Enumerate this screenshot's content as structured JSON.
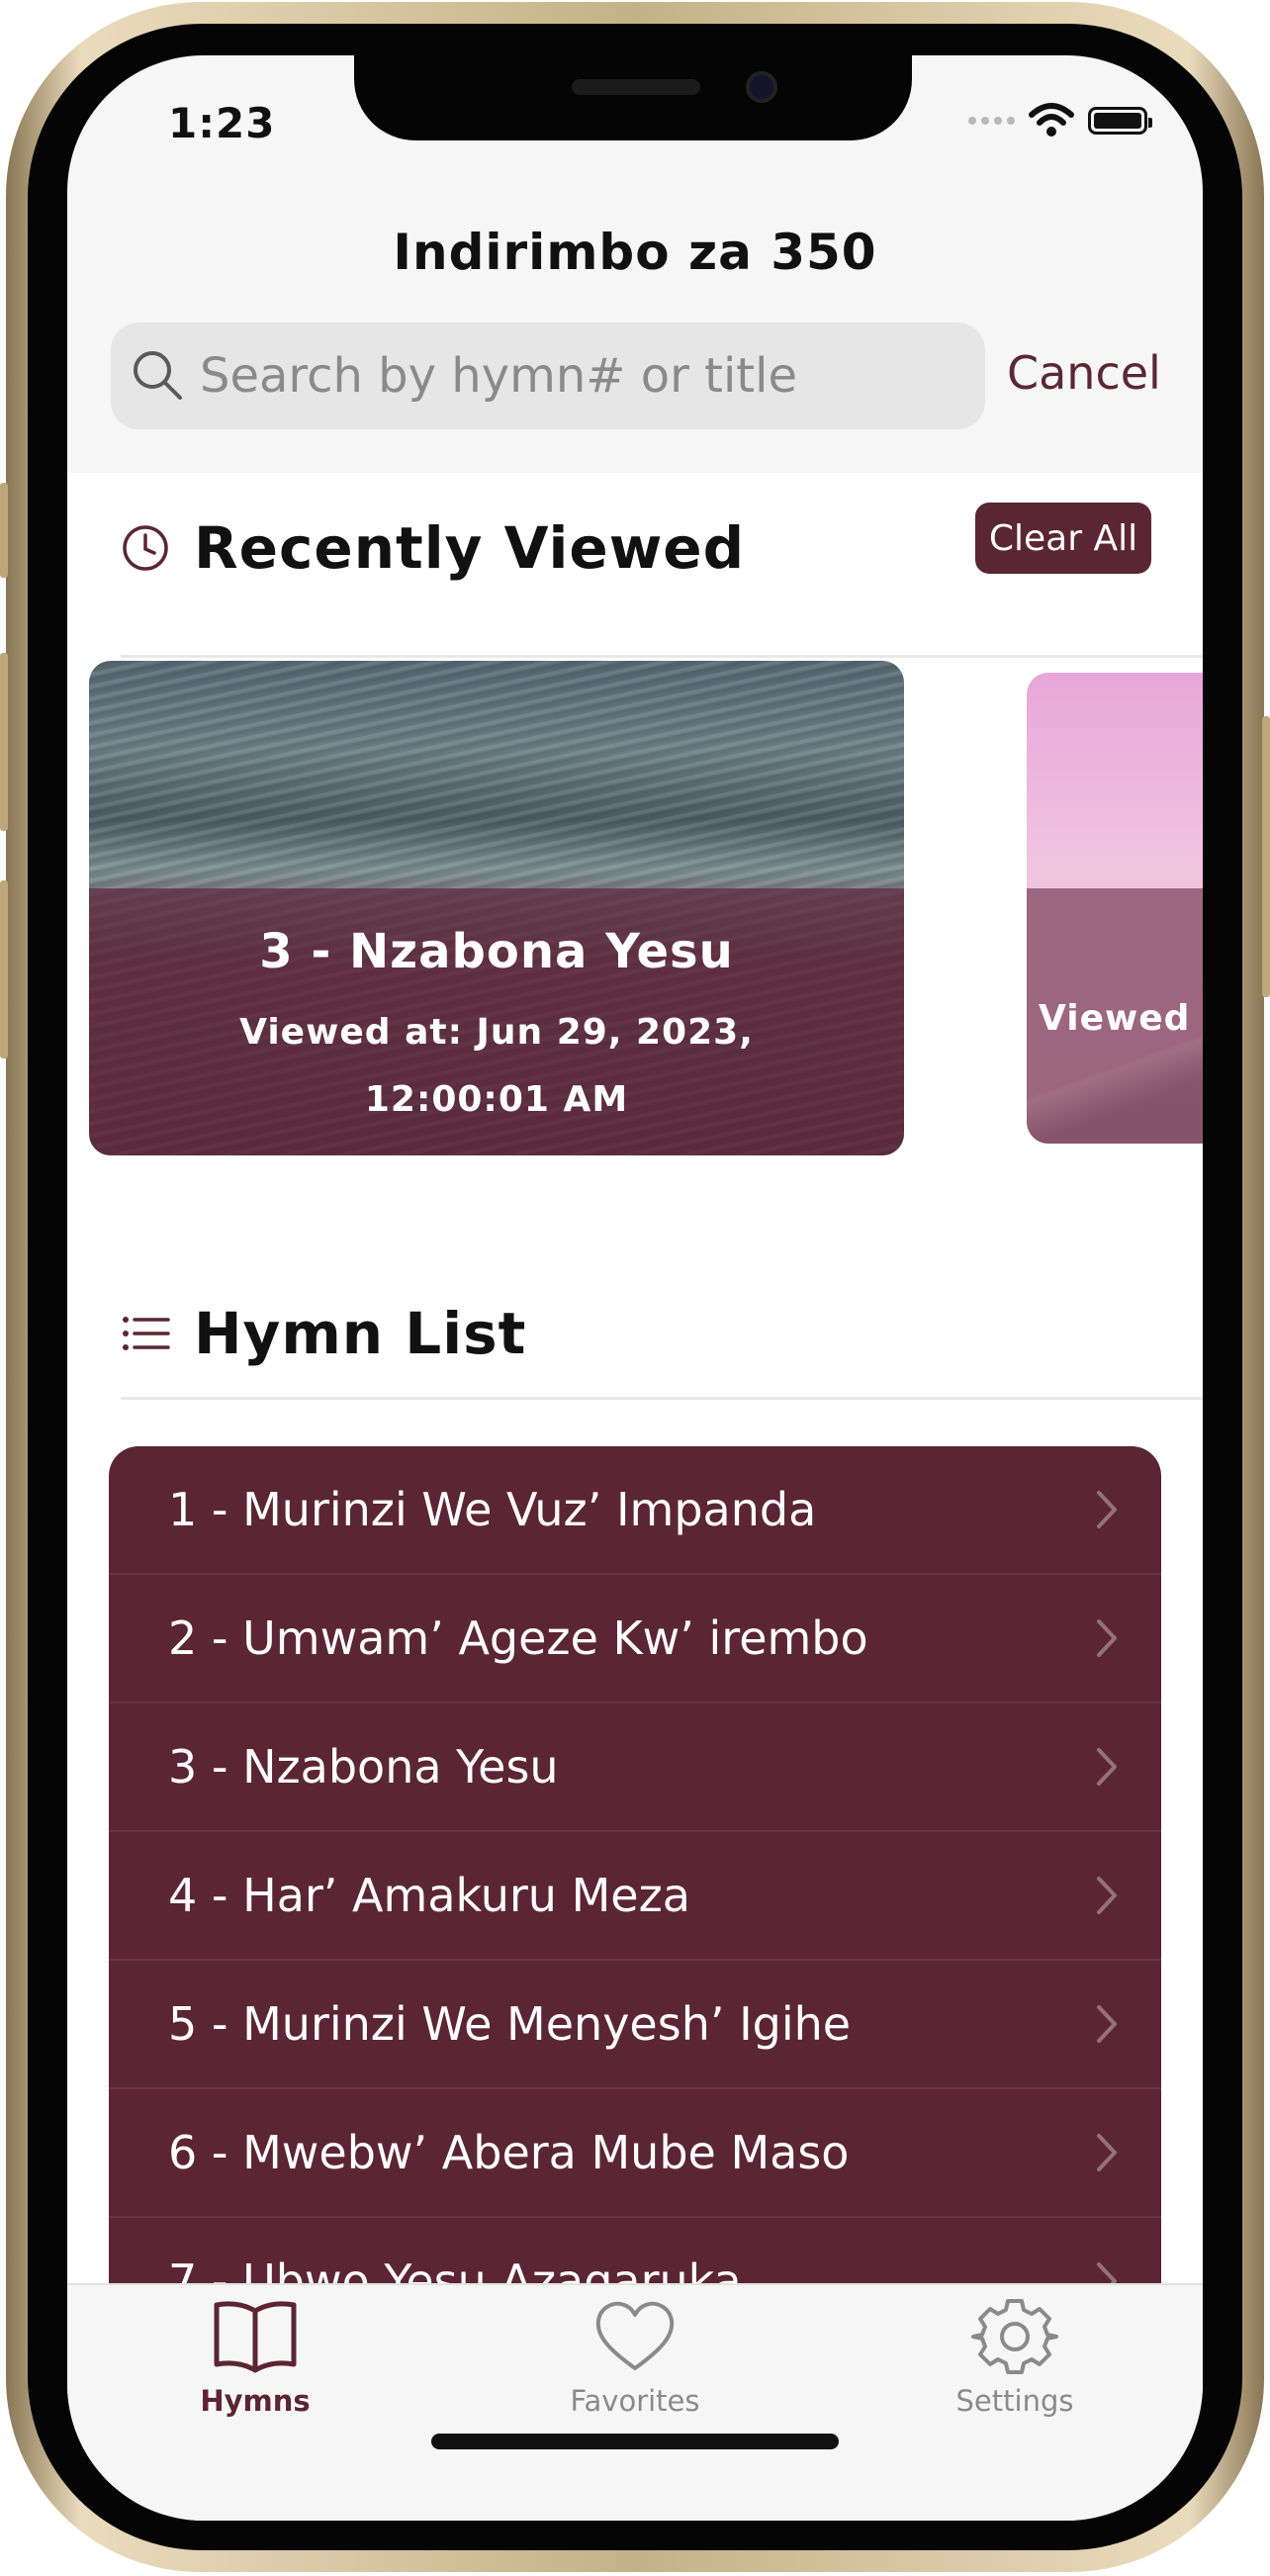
{
  "status_bar": {
    "time": "1:23"
  },
  "header": {
    "title": "Indirimbo za 350",
    "search_placeholder": "Search by hymn# or title",
    "cancel_label": "Cancel"
  },
  "recent": {
    "title": "Recently Viewed",
    "clear_label": "Clear All",
    "cards": [
      {
        "title": "3 - Nzabona Yesu",
        "viewed": "Viewed at: Jun 29, 2023, 12:00:01 AM"
      },
      {
        "title": "",
        "viewed": "Viewed"
      }
    ]
  },
  "hymn_list": {
    "title": "Hymn List",
    "items": [
      "1 - Murinzi We Vuz’ Impanda",
      "2 - Umwam’ Ageze Kw’ irembo",
      "3 - Nzabona Yesu",
      "4 - Har’ Amakuru Meza",
      "5 - Murinzi We Menyesh’ Igihe",
      "6 - Mwebw’ Abera Mube Maso",
      "7 - Ubwo Yesu Azagaruka"
    ]
  },
  "tabs": [
    {
      "label": "Hymns",
      "icon": "book-icon",
      "active": true
    },
    {
      "label": "Favorites",
      "icon": "heart-icon",
      "active": false
    },
    {
      "label": "Settings",
      "icon": "gear-icon",
      "active": false
    }
  ],
  "colors": {
    "accent": "#5b2535",
    "inactive": "#8a8a8a"
  }
}
